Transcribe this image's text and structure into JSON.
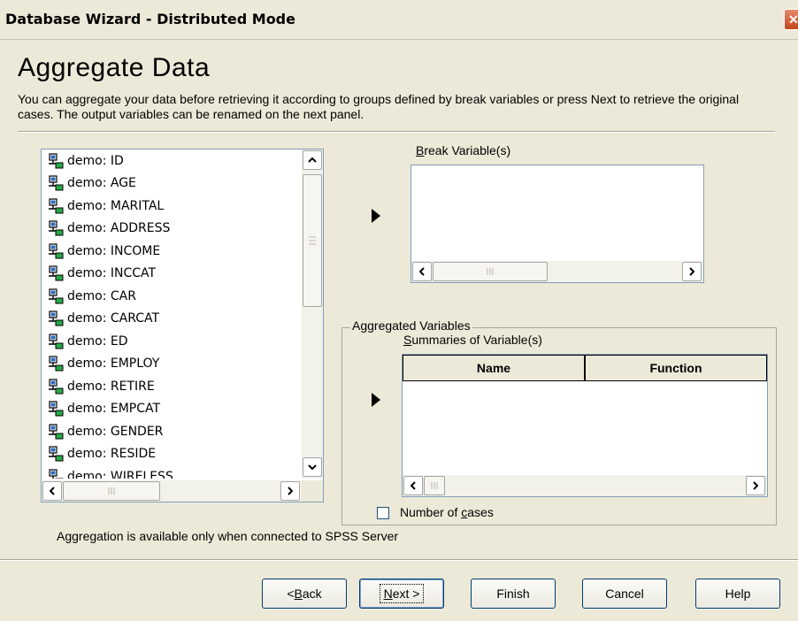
{
  "window": {
    "title": "Database Wizard - Distributed Mode",
    "close_glyph": "✕"
  },
  "page": {
    "heading": "Aggregate Data",
    "description": "You can aggregate your data before retrieving it according to groups defined by break variables or press Next to retrieve the original cases. The output variables can be renamed on the next panel."
  },
  "variables": [
    "demo: ID",
    "demo: AGE",
    "demo: MARITAL",
    "demo: ADDRESS",
    "demo: INCOME",
    "demo: INCCAT",
    "demo: CAR",
    "demo: CARCAT",
    "demo: ED",
    "demo: EMPLOY",
    "demo: RETIRE",
    "demo: EMPCAT",
    "demo: GENDER",
    "demo: RESIDE",
    "demo: WIRELESS"
  ],
  "break_vars": {
    "label_key": "B",
    "label_rest": "reak Variable(s)"
  },
  "aggregated": {
    "group_title": "Aggregated Variables",
    "summaries_key": "S",
    "summaries_rest": "ummaries of Variable(s)",
    "columns": [
      "Name",
      "Function"
    ]
  },
  "number_of_cases": {
    "label_before": "Number of ",
    "label_key": "c",
    "label_rest": "ases",
    "checked": false
  },
  "status_note": "Aggregation is available only when connected to SPSS Server",
  "buttons": {
    "back_pre": "< ",
    "back_key": "B",
    "back_rest": "ack",
    "next_key": "N",
    "next_rest": "ext >",
    "finish": "Finish",
    "cancel": "Cancel",
    "help": "Help"
  },
  "icons": {
    "variable": "string-variable-icon",
    "move_arrow": "right-arrow-icon"
  },
  "colors": {
    "dialog_bg": "#ece9d8",
    "border_blue": "#7f9db9",
    "button_border": "#003c74"
  }
}
